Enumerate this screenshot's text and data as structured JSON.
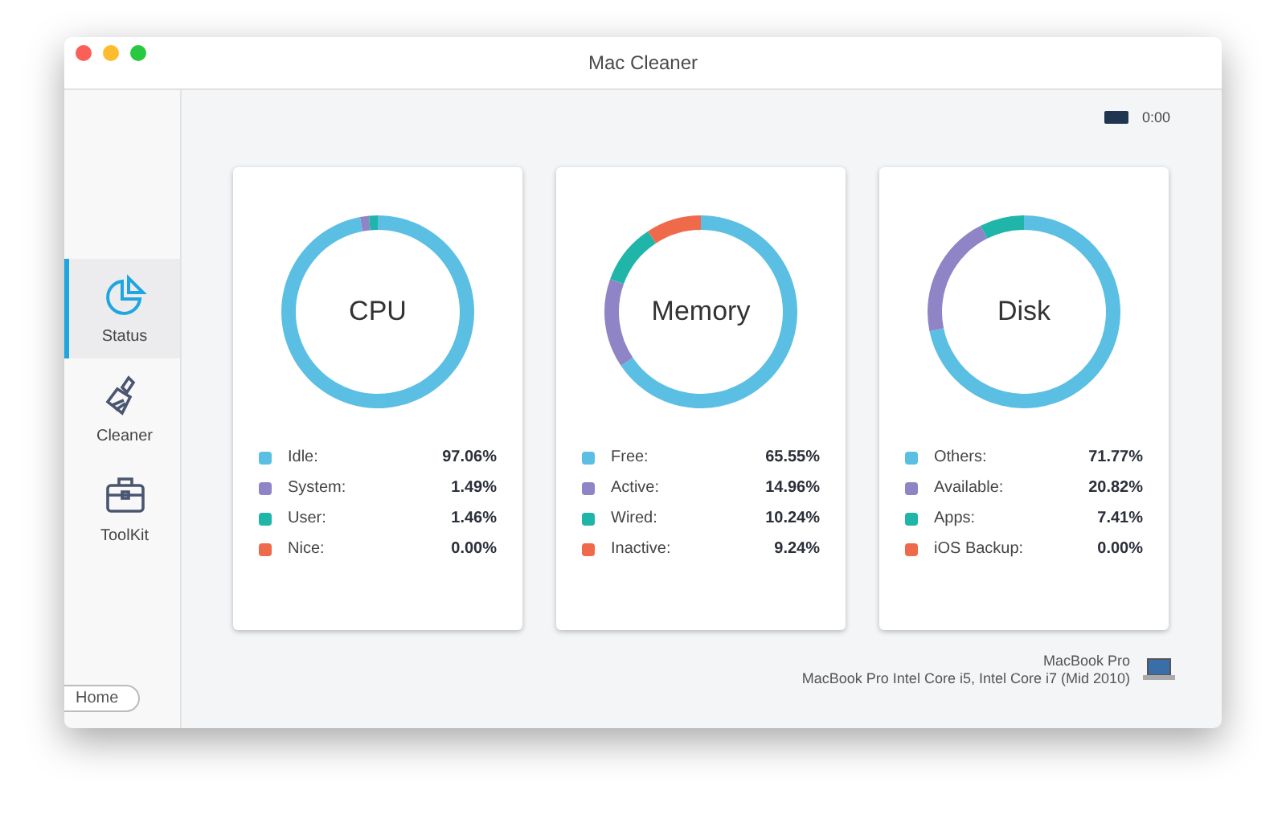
{
  "window": {
    "title": "Mac Cleaner"
  },
  "sidebar": {
    "items": [
      {
        "label": "Status",
        "selected": true
      },
      {
        "label": "Cleaner",
        "selected": false
      },
      {
        "label": "ToolKit",
        "selected": false
      }
    ],
    "home_button": "Home"
  },
  "timer": {
    "value": "0:00"
  },
  "cards": [
    {
      "chart_data": {
        "type": "donut",
        "title": "CPU",
        "values": [
          97.06,
          1.49,
          1.46,
          0.0
        ]
      },
      "legend": [
        {
          "label": "Idle:",
          "value": "97.06%",
          "color": "#5bbfe3"
        },
        {
          "label": "System:",
          "value": "1.49%",
          "color": "#8e84c6"
        },
        {
          "label": "User:",
          "value": "1.46%",
          "color": "#1fb5a9"
        },
        {
          "label": "Nice:",
          "value": "0.00%",
          "color": "#ef6a4a"
        }
      ]
    },
    {
      "chart_data": {
        "type": "donut",
        "title": "Memory",
        "values": [
          65.55,
          14.96,
          10.24,
          9.24
        ]
      },
      "legend": [
        {
          "label": "Free:",
          "value": "65.55%",
          "color": "#5bbfe3"
        },
        {
          "label": "Active:",
          "value": "14.96%",
          "color": "#8e84c6"
        },
        {
          "label": "Wired:",
          "value": "10.24%",
          "color": "#1fb5a9"
        },
        {
          "label": "Inactive:",
          "value": "9.24%",
          "color": "#ef6a4a"
        }
      ]
    },
    {
      "chart_data": {
        "type": "donut",
        "title": "Disk",
        "values": [
          71.77,
          20.82,
          7.41,
          0.0
        ]
      },
      "legend": [
        {
          "label": "Others:",
          "value": "71.77%",
          "color": "#5bbfe3"
        },
        {
          "label": "Available:",
          "value": "20.82%",
          "color": "#8e84c6"
        },
        {
          "label": "Apps:",
          "value": "7.41%",
          "color": "#1fb5a9"
        },
        {
          "label": "iOS Backup:",
          "value": "0.00%",
          "color": "#ef6a4a"
        }
      ]
    }
  ],
  "device": {
    "name": "MacBook Pro",
    "model": "MacBook Pro Intel Core i5, Intel Core i7 (Mid 2010)"
  }
}
